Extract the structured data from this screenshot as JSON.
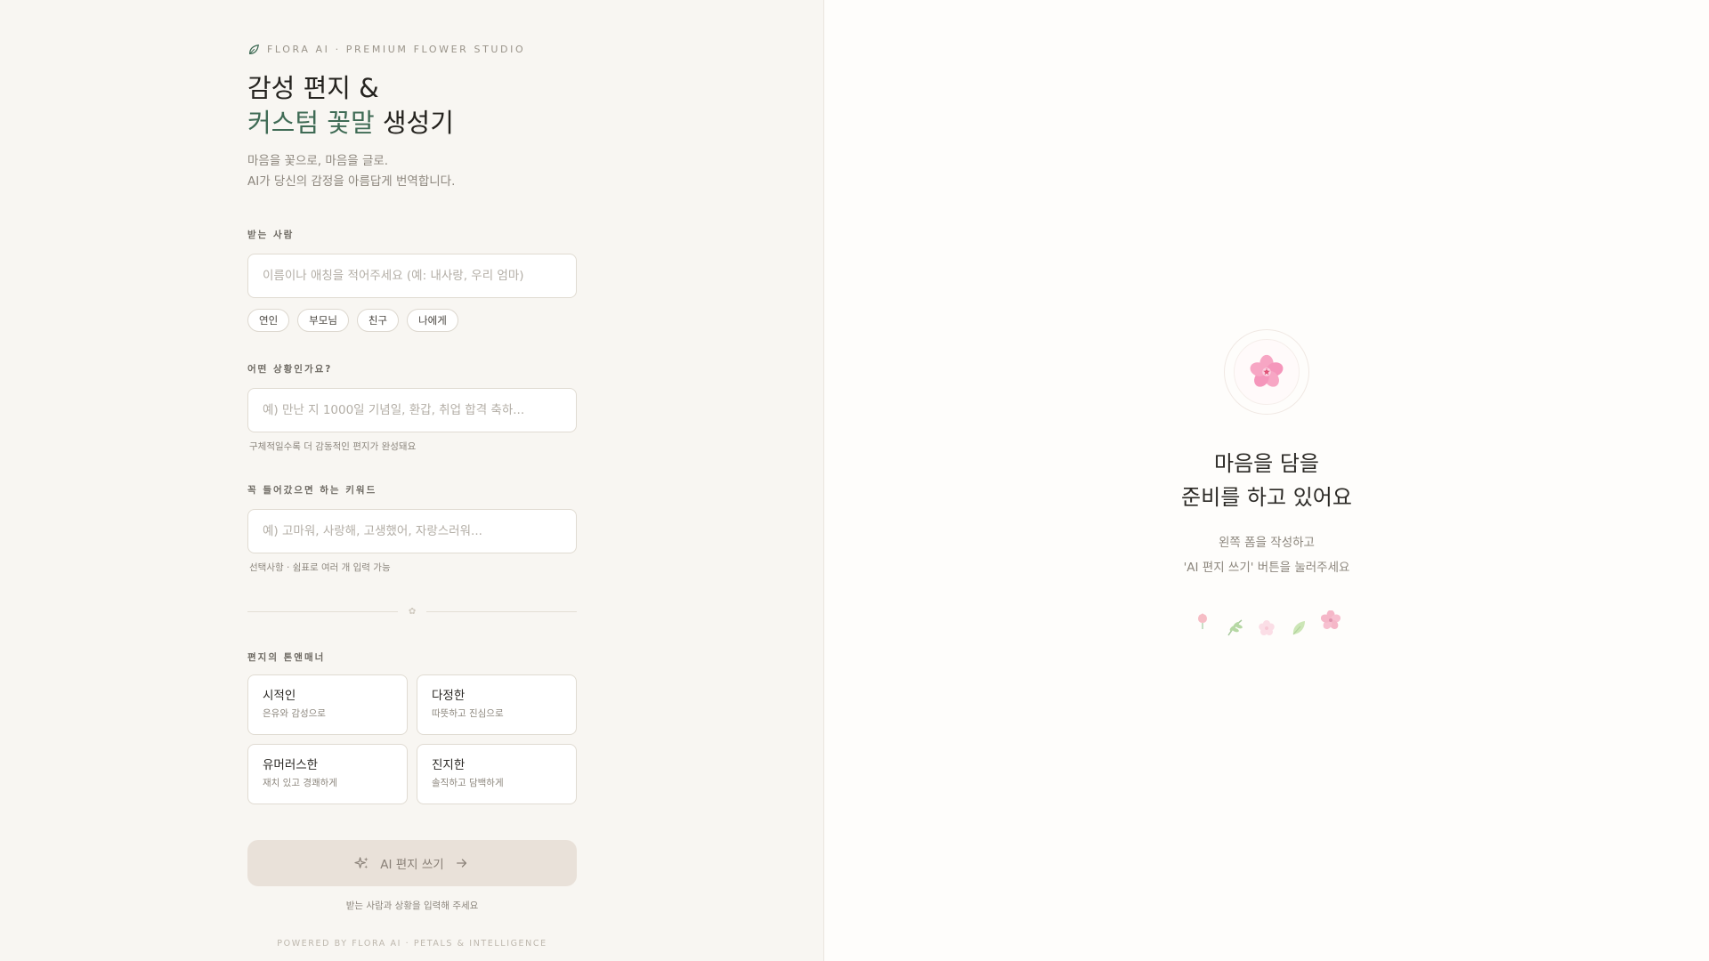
{
  "brand": {
    "icon": "leaf-icon",
    "text": "FLORA AI · PREMIUM FLOWER STUDIO"
  },
  "hero": {
    "title_line1": "감성 편지 &",
    "title_accent": "커스텀 꽃말",
    "title_rest": " 생성기",
    "subtitle_line1": "마음을 꽃으로, 마음을 글로.",
    "subtitle_line2": "AI가 당신의 감정을 아름답게 번역합니다."
  },
  "recipient": {
    "label": "받는 사람",
    "value": "",
    "placeholder": "이름이나 애칭을 적어주세요 (예: 내사랑, 우리 엄마)",
    "chips": [
      "연인",
      "부모님",
      "친구",
      "나에게"
    ]
  },
  "situation": {
    "label": "어떤 상황인가요?",
    "value": "",
    "placeholder": "예) 만난 지 1000일 기념일, 환갑, 취업 합격 축하...",
    "hint": "구체적일수록 더 감동적인 편지가 완성돼요"
  },
  "keywords": {
    "label": "꼭 들어갔으면 하는 키워드",
    "value": "",
    "placeholder": "예) 고마워, 사랑해, 고생했어, 자랑스러워...",
    "hint": "선택사항 · 쉼표로 여러 개 입력 가능"
  },
  "tone": {
    "label": "편지의 톤앤매너",
    "options": [
      {
        "name": "시적인",
        "desc": "은유와 감성으로"
      },
      {
        "name": "다정한",
        "desc": "따뜻하고 진심으로"
      },
      {
        "name": "유머러스한",
        "desc": "재치 있고 경쾌하게"
      },
      {
        "name": "진지한",
        "desc": "솔직하고 담백하게"
      }
    ]
  },
  "submit": {
    "icon": "sparkles-icon",
    "label": "AI 편지 쓰기",
    "arrow_icon": "arrow-right-icon",
    "hint": "받는 사람과 상황을 입력해 주세요"
  },
  "footer": {
    "powered": "POWERED BY FLORA AI · PETALS & INTELLIGENCE"
  },
  "empty_state": {
    "icon": "cherry-blossom-icon",
    "title_line1": "마음을 담을",
    "title_line2": "준비를 하고 있어요",
    "desc_line1": "왼쪽 폼을 작성하고",
    "desc_line2": "'AI 편지 쓰기' 버튼을 눌러주세요",
    "decorations": [
      "rose-icon",
      "herb-icon",
      "blossom-icon",
      "leaf-icon",
      "hibiscus-icon"
    ]
  },
  "colors": {
    "accent": "#3f6b55",
    "button_bg": "#e9e1d9",
    "panel_bg": "#f8f6f2"
  }
}
